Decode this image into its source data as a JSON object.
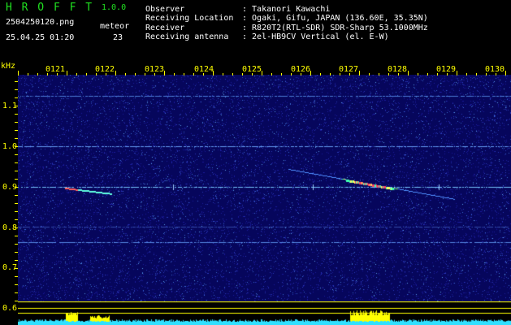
{
  "header": {
    "app_name": "H R O F F T",
    "version": "1.0.0",
    "filename": "2504250120.png",
    "mode_label": "meteor",
    "datetime": "25.04.25 01:20",
    "count": "23",
    "info_rows": [
      {
        "label": "Observer",
        "value": ": Takanori Kawachi"
      },
      {
        "label": "Receiving Location",
        "value": ": Ogaki, Gifu, JAPAN (136.60E, 35.35N)"
      },
      {
        "label": "Receiver",
        "value": ": R820T2(RTL-SDR) SDR-Sharp 53.1000MHz"
      },
      {
        "label": "Receiving antenna",
        "value": ": 2el-HB9CV Vertical (el. E-W)"
      }
    ]
  },
  "axes": {
    "y_unit": "kHz",
    "time_labels": [
      "0121",
      "0122",
      "0123",
      "0124",
      "0125",
      "0126",
      "0127",
      "0128",
      "0129",
      "0130"
    ],
    "freq_labels": [
      "1.1",
      "1.0",
      "0.9",
      "0.8",
      "0.7",
      "0.6"
    ]
  },
  "colors": {
    "background": "#000000",
    "spectrogram_bg": "#05055a",
    "text_green": "#20e020",
    "text_white": "#ffffff",
    "axis_yellow": "#ffff00",
    "band_cyan": "#30e0ff",
    "band_yellow": "#ffff00"
  }
}
